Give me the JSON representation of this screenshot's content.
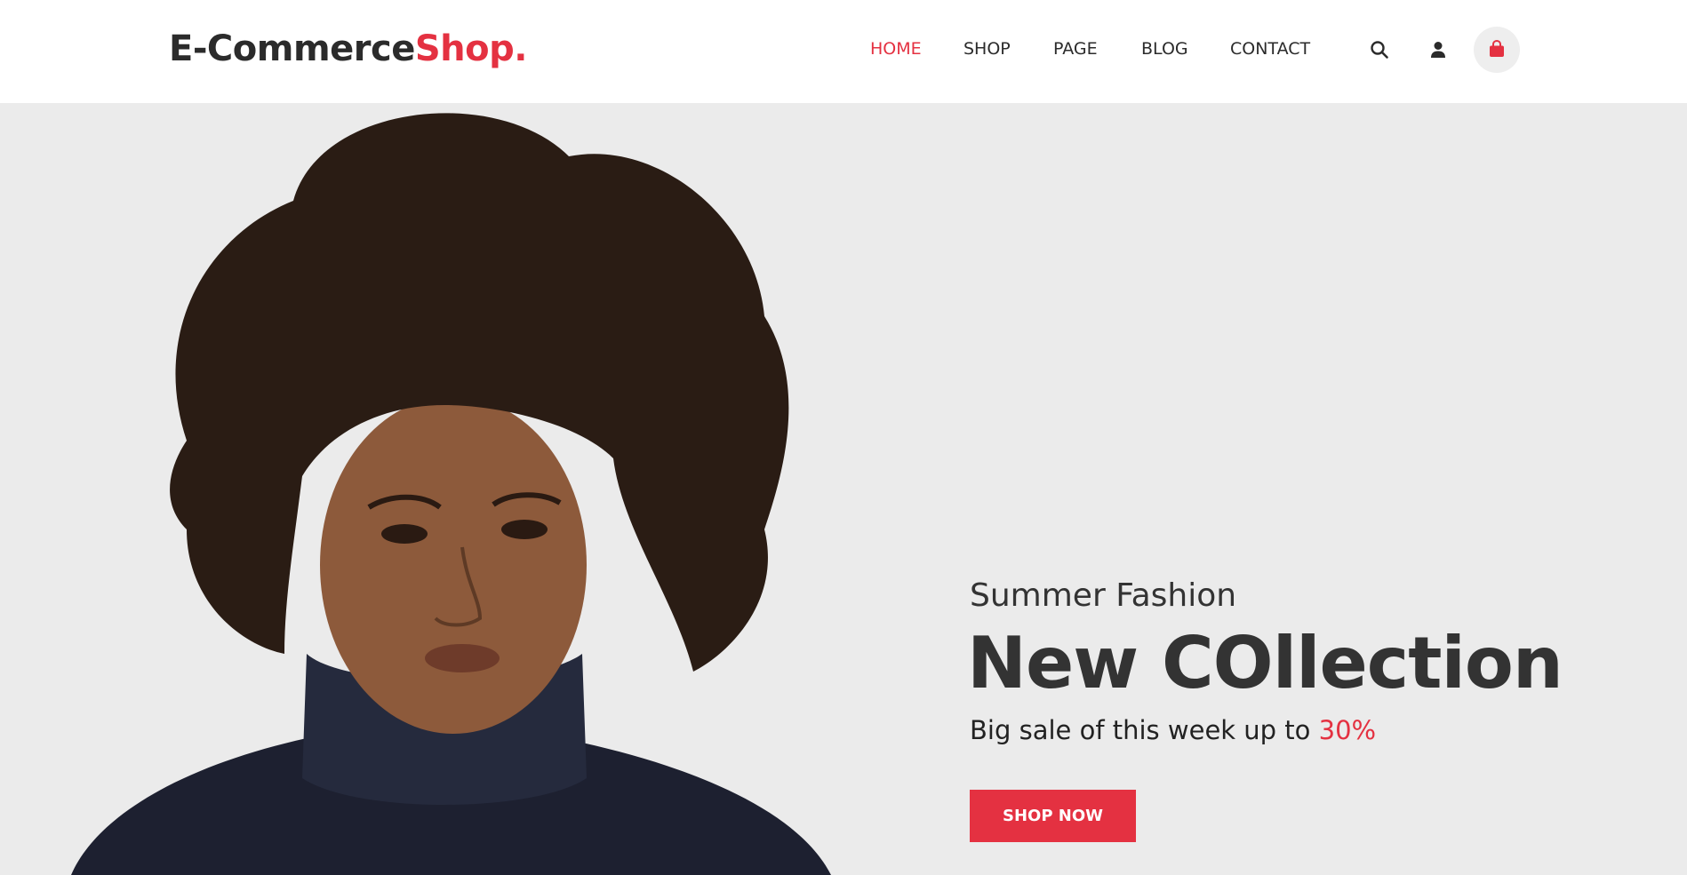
{
  "logo": {
    "main": "E-Commerce",
    "accent": "Shop."
  },
  "nav": {
    "items": [
      {
        "label": "HOME",
        "active": true
      },
      {
        "label": "SHOP",
        "active": false
      },
      {
        "label": "PAGE",
        "active": false
      },
      {
        "label": "BLOG",
        "active": false
      },
      {
        "label": "CONTACT",
        "active": false
      }
    ]
  },
  "header_icons": [
    "search-icon",
    "user-icon",
    "shopping-bag-icon"
  ],
  "hero": {
    "subtitle": "Summer Fashion",
    "headline": "New COllection",
    "sale_text": "Big sale of this week up to ",
    "sale_percent": "30%",
    "button_label": "SHOP NOW"
  },
  "colors": {
    "accent": "#e43141",
    "text_dark": "#2b2b2b",
    "hero_bg": "#ebebeb",
    "header_bg": "#ffffff"
  }
}
